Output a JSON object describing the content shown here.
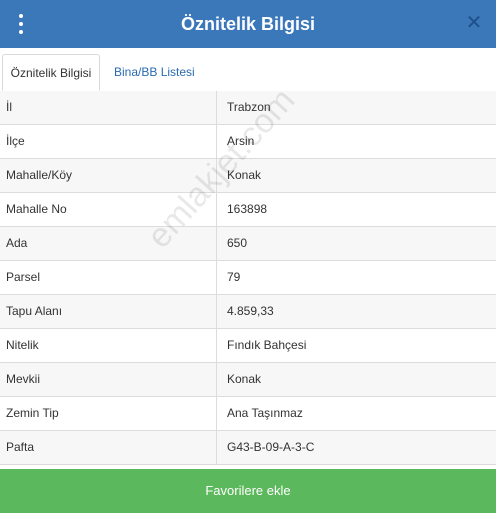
{
  "header": {
    "title": "Öznitelik Bilgisi",
    "close_glyph": "✕"
  },
  "tabs": [
    {
      "label": "Öznitelik Bilgisi",
      "active": true
    },
    {
      "label": "Bina/BB Listesi",
      "active": false
    }
  ],
  "rows": [
    {
      "key": "İl",
      "value": "Trabzon"
    },
    {
      "key": "İlçe",
      "value": "Arsin"
    },
    {
      "key": "Mahalle/Köy",
      "value": "Konak"
    },
    {
      "key": "Mahalle No",
      "value": "163898"
    },
    {
      "key": "Ada",
      "value": "650"
    },
    {
      "key": "Parsel",
      "value": "79"
    },
    {
      "key": "Tapu Alanı",
      "value": "4.859,33"
    },
    {
      "key": "Nitelik",
      "value": "Fındık Bahçesi"
    },
    {
      "key": "Mevkii",
      "value": "Konak"
    },
    {
      "key": "Zemin Tip",
      "value": "Ana Taşınmaz"
    },
    {
      "key": "Pafta",
      "value": "G43-B-09-A-3-C"
    }
  ],
  "watermark": "emlakjet.com",
  "footer": {
    "favorite_label": "Favorilere ekle"
  },
  "colors": {
    "header": "#3a78b9",
    "footer_button": "#5cb85c",
    "tab_link": "#2a6ab0"
  }
}
